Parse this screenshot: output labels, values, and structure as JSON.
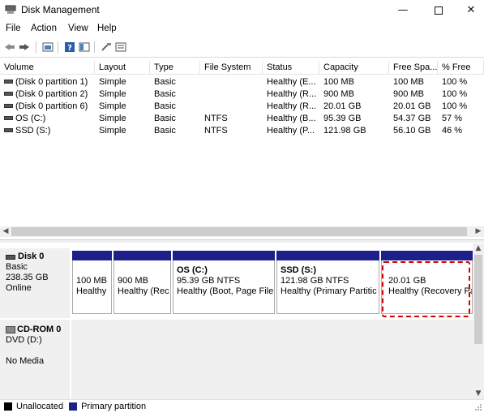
{
  "window": {
    "title": "Disk Management"
  },
  "menu": [
    "File",
    "Action",
    "View",
    "Help"
  ],
  "toolbar": [
    "back-icon",
    "forward-icon",
    "properties-icon",
    "help-icon",
    "console-icon",
    "rescan-icon",
    "details-icon"
  ],
  "volume_table": {
    "columns": [
      "Volume",
      "Layout",
      "Type",
      "File System",
      "Status",
      "Capacity",
      "Free Spa...",
      "% Free"
    ],
    "rows": [
      [
        "(Disk 0 partition 1)",
        "Simple",
        "Basic",
        "",
        "Healthy (E...",
        "100 MB",
        "100 MB",
        "100 %"
      ],
      [
        "(Disk 0 partition 2)",
        "Simple",
        "Basic",
        "",
        "Healthy (R...",
        "900 MB",
        "900 MB",
        "100 %"
      ],
      [
        "(Disk 0 partition 6)",
        "Simple",
        "Basic",
        "",
        "Healthy (R...",
        "20.01 GB",
        "20.01 GB",
        "100 %"
      ],
      [
        "OS (C:)",
        "Simple",
        "Basic",
        "NTFS",
        "Healthy (B...",
        "95.39 GB",
        "54.37 GB",
        "57 %"
      ],
      [
        "SSD (S:)",
        "Simple",
        "Basic",
        "NTFS",
        "Healthy (P...",
        "121.98 GB",
        "56.10 GB",
        "46 %"
      ]
    ]
  },
  "disk0": {
    "name": "Disk 0",
    "type": "Basic",
    "size": "238.35 GB",
    "status": "Online",
    "partitions": [
      {
        "name": "",
        "size": "100 MB",
        "status": "Healthy"
      },
      {
        "name": "",
        "size": "900 MB",
        "status": "Healthy (Rec"
      },
      {
        "name": "OS  (C:)",
        "size": "95.39 GB NTFS",
        "status": "Healthy (Boot, Page File"
      },
      {
        "name": "SSD  (S:)",
        "size": "121.98 GB NTFS",
        "status": "Healthy (Primary Partitic"
      },
      {
        "name": "",
        "size": "20.01 GB",
        "status": "Healthy (Recovery Pa"
      }
    ]
  },
  "cdrom0": {
    "name": "CD-ROM 0",
    "drive": "DVD (D:)",
    "status": "No Media"
  },
  "legend": [
    {
      "label": "Unallocated",
      "color": "#000000"
    },
    {
      "label": "Primary partition",
      "color": "#1f1f8a"
    }
  ],
  "colors": {
    "partition_bar": "#1f1f8a",
    "highlight": "#d40000"
  }
}
